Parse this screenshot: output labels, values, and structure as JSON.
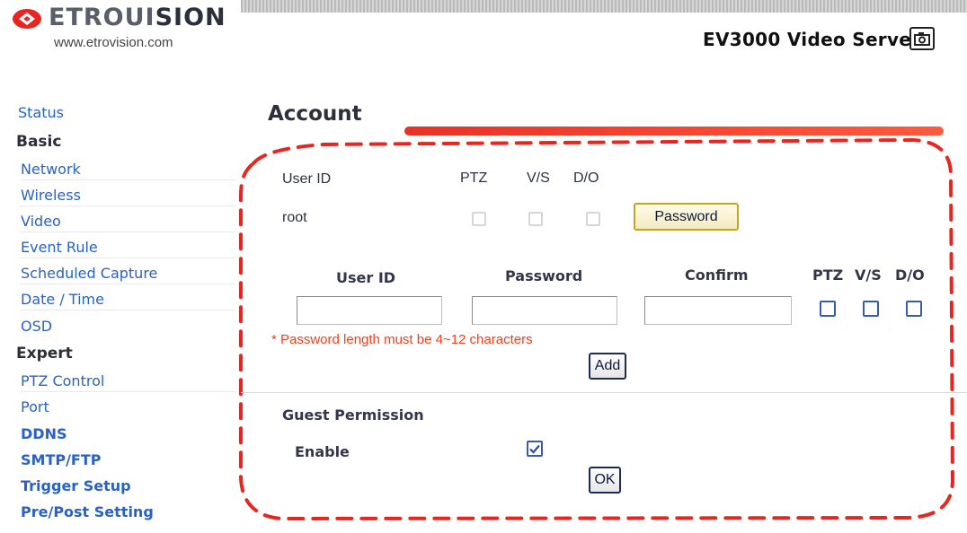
{
  "header": {
    "brand_a": "ETROUI",
    "brand_b": "SION",
    "website": "www.etrovision.com",
    "product_title": "EV3000 Video Server",
    "product_icon": "camera-icon",
    "accent_color": "#e83227"
  },
  "sidebar": {
    "status": "Status",
    "basic": "Basic",
    "basic_items": [
      "Network",
      "Wireless",
      "Video",
      "Event Rule",
      "Scheduled Capture",
      "Date / Time",
      "OSD"
    ],
    "expert": "Expert",
    "expert_items": [
      "PTZ Control",
      "Port",
      "DDNS",
      "SMTP/FTP",
      "Trigger Setup",
      "Pre/Post Setting"
    ]
  },
  "page": {
    "title": "Account",
    "existing": {
      "col_user": "User ID",
      "col_ptz": "PTZ",
      "col_vs": "V/S",
      "col_do": "D/O",
      "row_user": "root",
      "password_button": "Password"
    },
    "add_form": {
      "col_user": "User ID",
      "col_password": "Password",
      "col_confirm": "Confirm",
      "col_ptz": "PTZ",
      "col_vs": "V/S",
      "col_do": "D/O",
      "user_value": "",
      "password_value": "",
      "confirm_value": "",
      "note": "* Password length must be 4~12 characters",
      "add_button": "Add"
    },
    "guest": {
      "heading": "Guest Permission",
      "enable_label": "Enable",
      "enabled": true,
      "ok_button": "OK"
    }
  }
}
